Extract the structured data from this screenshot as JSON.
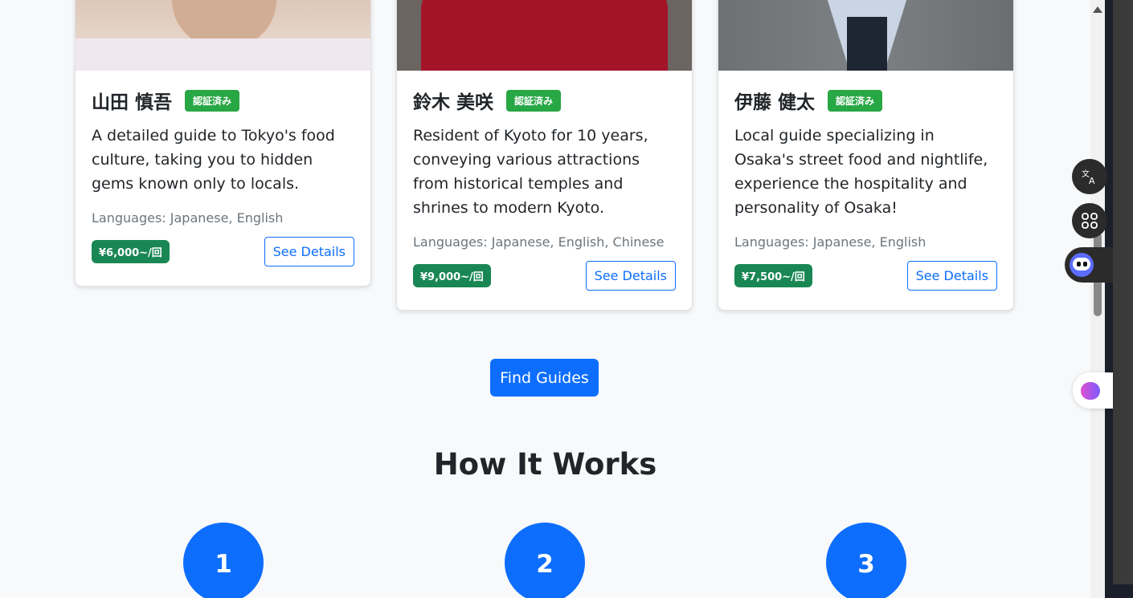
{
  "guides": [
    {
      "name": "山田 慎吾",
      "badge": "認証済み",
      "description": "A detailed guide to Tokyo's food culture, taking you to hidden gems known only to locals.",
      "languages": "Languages: Japanese, English",
      "price": "¥6,000~/回",
      "details_label": "See Details"
    },
    {
      "name": "鈴木 美咲",
      "badge": "認証済み",
      "description": "Resident of Kyoto for 10 years, conveying various attractions from historical temples and shrines to modern Kyoto.",
      "languages": "Languages: Japanese, English, Chinese",
      "price": "¥9,000~/回",
      "details_label": "See Details"
    },
    {
      "name": "伊藤 健太",
      "badge": "認証済み",
      "description": "Local guide specializing in Osaka's street food and nightlife, experience the hospitality and personality of Osaka!",
      "languages": "Languages: Japanese, English",
      "price": "¥7,500~/回",
      "details_label": "See Details"
    }
  ],
  "find_guides_label": "Find Guides",
  "how_it_works": {
    "title": "How It Works",
    "steps": [
      "1",
      "2",
      "3"
    ]
  },
  "widgets": {
    "translate_icon": "translate-icon",
    "apps_icon": "apps-grid-icon",
    "assistant_icon": "assistant-bot-icon",
    "brain_icon": "brain-icon"
  },
  "colors": {
    "primary": "#0d6efd",
    "verified": "#28a745",
    "price": "#198754"
  }
}
